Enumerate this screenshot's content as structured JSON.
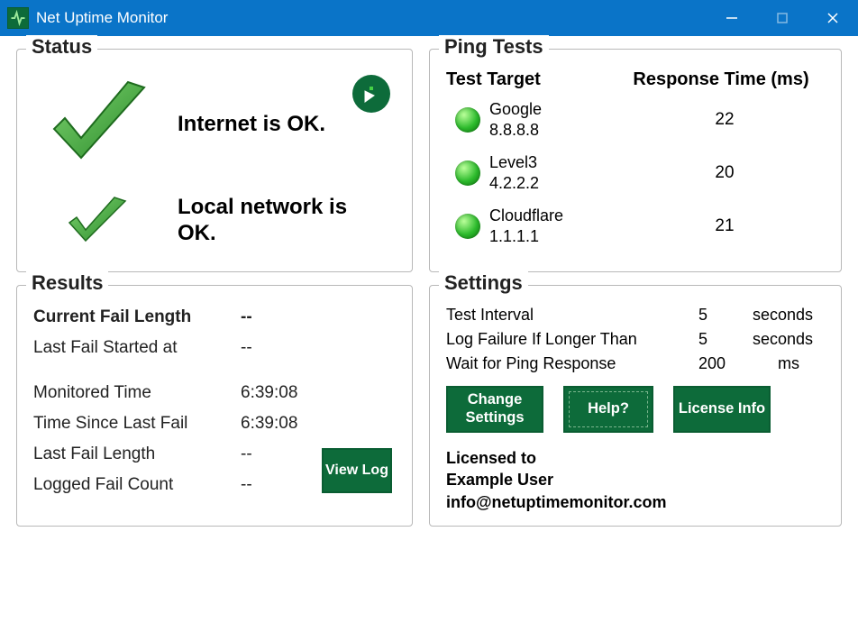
{
  "window": {
    "title": "Net Uptime Monitor"
  },
  "status": {
    "title": "Status",
    "internet": "Internet is OK.",
    "local": "Local network is OK."
  },
  "ping": {
    "title": "Ping Tests",
    "header_target": "Test Target",
    "header_resp": "Response Time (ms)",
    "targets": [
      {
        "name": "Google",
        "addr": "8.8.8.8",
        "resp": "22"
      },
      {
        "name": "Level3",
        "addr": "4.2.2.2",
        "resp": "20"
      },
      {
        "name": "Cloudflare",
        "addr": "1.1.1.1",
        "resp": "21"
      }
    ]
  },
  "results": {
    "title": "Results",
    "rows": [
      {
        "label": "Current Fail Length",
        "value": "--",
        "bold": true
      },
      {
        "label": "Last Fail Started at",
        "value": "--"
      },
      {
        "label": "Monitored Time",
        "value": "6:39:08"
      },
      {
        "label": "Time Since Last Fail",
        "value": "6:39:08"
      },
      {
        "label": "Last Fail Length",
        "value": "--"
      },
      {
        "label": "Logged Fail Count",
        "value": "--"
      }
    ],
    "view_log": "View Log"
  },
  "settings": {
    "title": "Settings",
    "rows": [
      {
        "label": "Test Interval",
        "value": "5",
        "unit": "seconds"
      },
      {
        "label": "Log Failure If Longer Than",
        "value": "5",
        "unit": "seconds"
      },
      {
        "label": "Wait for Ping Response",
        "value": "200",
        "unit": "ms"
      }
    ],
    "buttons": {
      "change": "Change Settings",
      "help": "Help?",
      "license": "License Info"
    },
    "licensed_to": "Licensed to",
    "user": "Example User",
    "email": "info@netuptimemonitor.com"
  }
}
